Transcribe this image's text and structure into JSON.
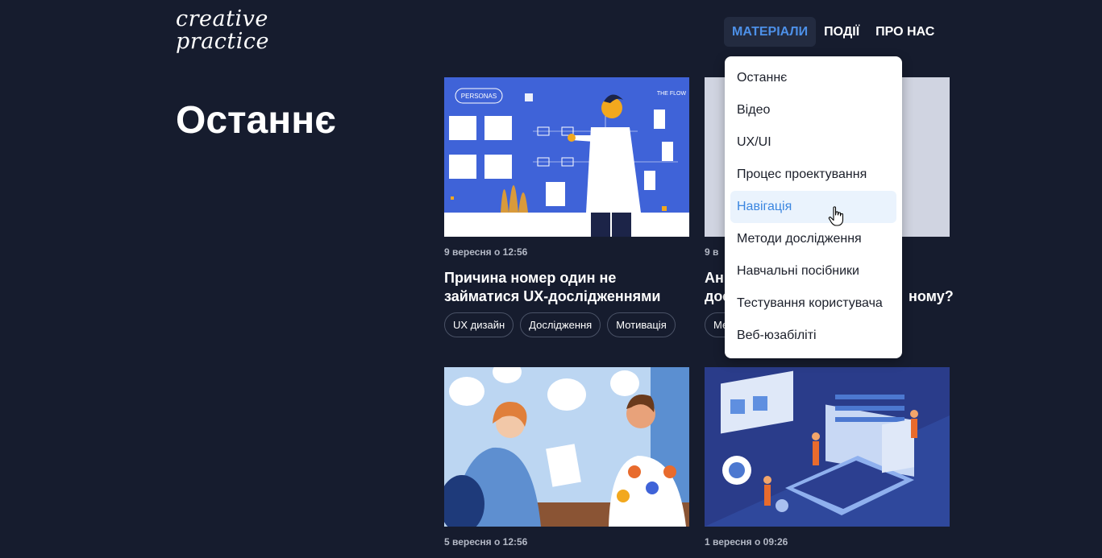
{
  "logo": {
    "line1": "creative",
    "line2": "practice"
  },
  "nav": {
    "items": [
      {
        "label": "МАТЕРІАЛИ",
        "active": true
      },
      {
        "label": "ПОДІЇ"
      },
      {
        "label": "ПРО НАС"
      }
    ]
  },
  "page": {
    "title": "Останнє"
  },
  "dropdown": {
    "items": [
      {
        "label": "Останнє"
      },
      {
        "label": "Відео"
      },
      {
        "label": "UX/UI"
      },
      {
        "label": "Процес проектування"
      },
      {
        "label": "Навігація",
        "hover": true
      },
      {
        "label": "Методи дослідження"
      },
      {
        "label": "Навчальні посібники"
      },
      {
        "label": "Тестування користувача"
      },
      {
        "label": "Веб-юзабіліті"
      }
    ]
  },
  "cards": [
    {
      "date": "9 вересня о 12:56",
      "title": "Причина номер один не займатися UX-дослідженнями",
      "tags": [
        "UX дизайн",
        "Дослідження",
        "Мотивація"
      ],
      "image_labels": {
        "personas": "PERSONAS",
        "flow": "THE FLOW"
      }
    },
    {
      "date_visible": "9 в",
      "title_line1_visible": "Ан",
      "title_line2_left": "дос",
      "title_line2_right": "ному?",
      "tag_visible": "Ме"
    },
    {
      "date": "5 вересня о 12:56"
    },
    {
      "date": "1 вересня о 09:26"
    }
  ],
  "colors": {
    "background": "#161c2e",
    "accent": "#4d90e8",
    "hover_bg": "#eaf3fd"
  }
}
